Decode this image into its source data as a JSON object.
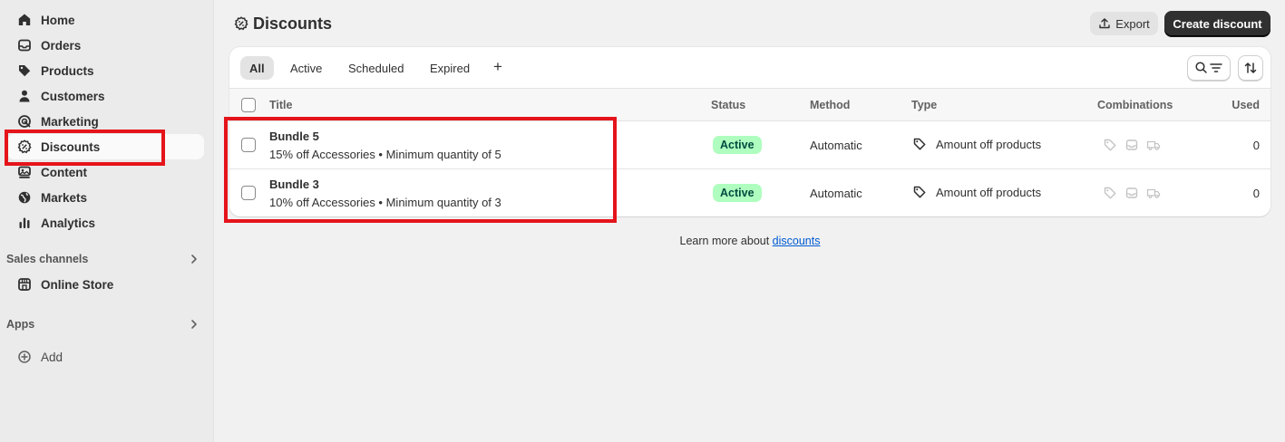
{
  "sidebar": {
    "items": [
      {
        "label": "Home",
        "icon": "home-icon"
      },
      {
        "label": "Orders",
        "icon": "inbox-icon"
      },
      {
        "label": "Products",
        "icon": "tag-icon"
      },
      {
        "label": "Customers",
        "icon": "person-icon"
      },
      {
        "label": "Marketing",
        "icon": "target-icon"
      },
      {
        "label": "Discounts",
        "icon": "discount-gear-icon"
      },
      {
        "label": "Content",
        "icon": "content-icon"
      },
      {
        "label": "Markets",
        "icon": "globe-icon"
      },
      {
        "label": "Analytics",
        "icon": "bar-chart-icon"
      }
    ],
    "sales_channels_label": "Sales channels",
    "online_store_label": "Online Store",
    "apps_label": "Apps",
    "add_label": "Add"
  },
  "header": {
    "title": "Discounts",
    "export_label": "Export",
    "create_label": "Create discount"
  },
  "tabs": [
    "All",
    "Active",
    "Scheduled",
    "Expired"
  ],
  "tab_add": "+",
  "table": {
    "columns": {
      "title": "Title",
      "status": "Status",
      "method": "Method",
      "type": "Type",
      "combinations": "Combinations",
      "used": "Used"
    },
    "rows": [
      {
        "title": "Bundle 5",
        "subtitle": "15% off Accessories • Minimum quantity of 5",
        "status": "Active",
        "method": "Automatic",
        "type": "Amount off products",
        "used": "0"
      },
      {
        "title": "Bundle 3",
        "subtitle": "10% off Accessories • Minimum quantity of 3",
        "status": "Active",
        "method": "Automatic",
        "type": "Amount off products",
        "used": "0"
      }
    ]
  },
  "footer": {
    "learn_prefix": "Learn more about ",
    "learn_link": "discounts"
  },
  "colors": {
    "highlight": "#e5141b",
    "active_badge_bg": "#affebf",
    "primary_button": "#303030",
    "link": "#005bd3"
  }
}
